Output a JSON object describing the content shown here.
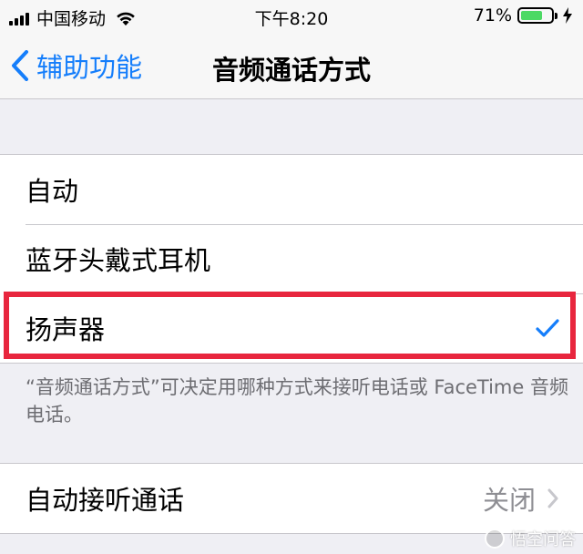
{
  "status_bar": {
    "carrier": "中国移动",
    "time": "下午8:20",
    "battery_percent": "71%",
    "battery_level": 0.71,
    "battery_color": "#4cd964"
  },
  "nav": {
    "back_label": "辅助功能",
    "title": "音频通话方式",
    "accent_color": "#157efb"
  },
  "routing_options": [
    {
      "label": "自动",
      "selected": false
    },
    {
      "label": "蓝牙头戴式耳机",
      "selected": false
    },
    {
      "label": "扬声器",
      "selected": true
    }
  ],
  "footnote": "“音频通话方式”可决定用哪种方式来接听电话或 FaceTime 音频电话。",
  "auto_answer": {
    "label": "自动接听通话",
    "value": "关闭"
  },
  "watermark": "悟空问答",
  "highlight_color": "#e8263e"
}
